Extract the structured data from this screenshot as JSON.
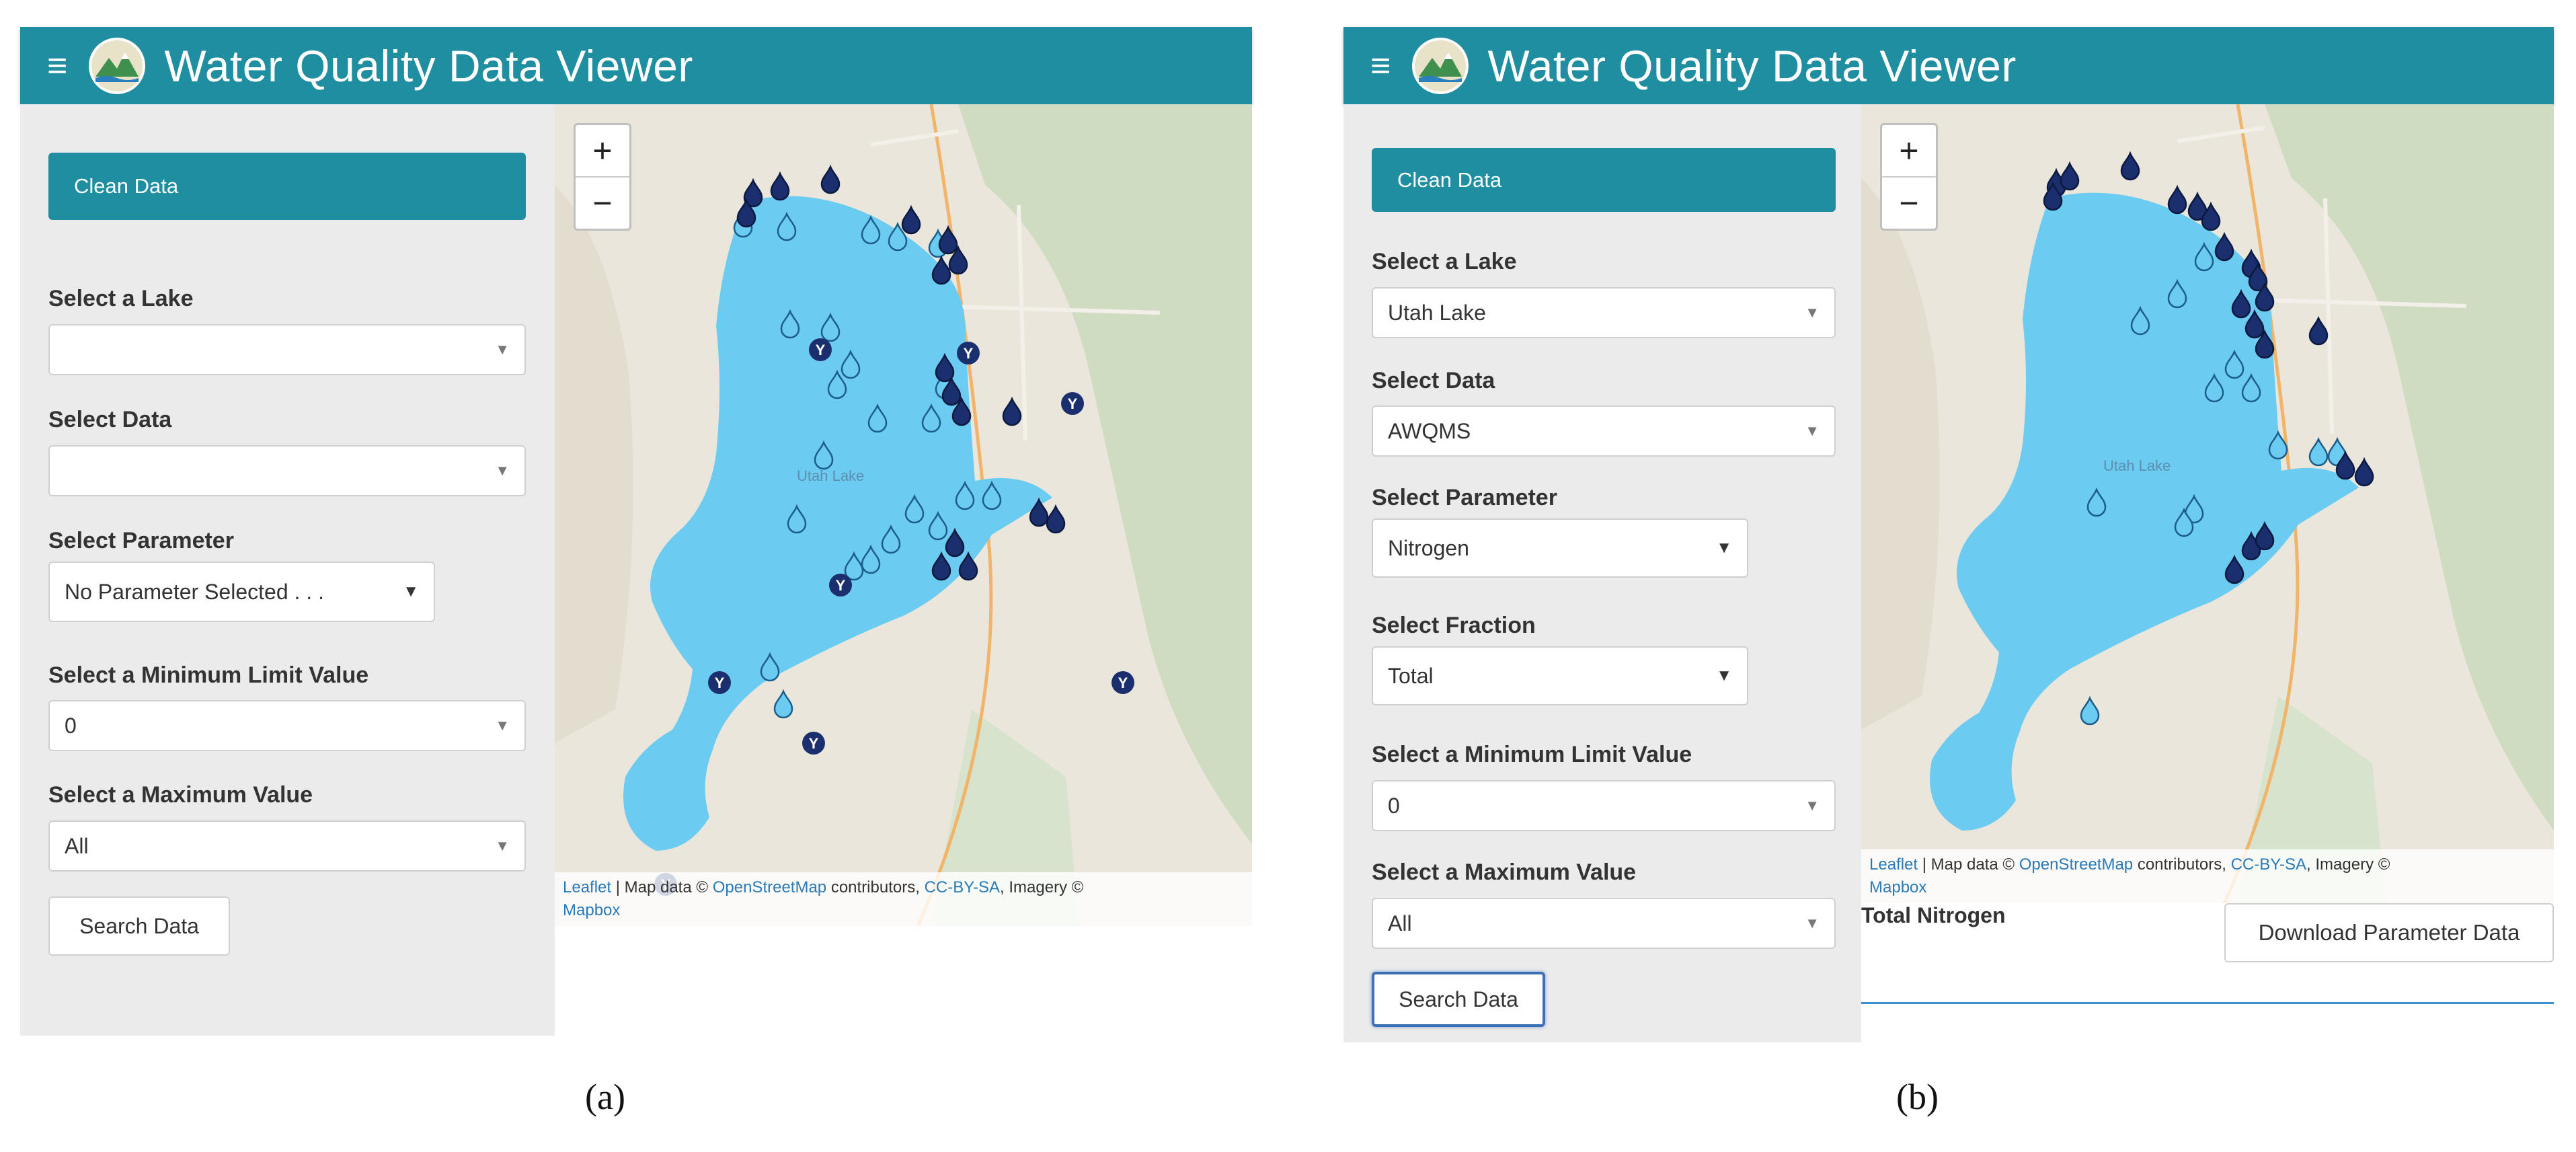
{
  "panels": {
    "a": {
      "header": {
        "title": "Water Quality Data Viewer"
      },
      "clean_button": "Clean Data",
      "labels": {
        "lake": "Select a Lake",
        "data": "Select Data",
        "parameter": "Select Parameter",
        "min": "Select a Minimum Limit Value",
        "max": "Select a Maximum Value"
      },
      "values": {
        "lake": "",
        "data": "",
        "parameter": "No Parameter Selected . . .",
        "min": "0",
        "max": "All"
      },
      "search_button": "Search Data",
      "map": {
        "zoom_in": "+",
        "zoom_out": "−",
        "lake_label": "Utah Lake",
        "attribution": {
          "leaflet": "Leaflet",
          "sep1": " | Map data © ",
          "osm": "OpenStreetMap",
          "sep2": " contributors, ",
          "license": "CC-BY-SA",
          "sep3": ", Imagery © ",
          "mapbox": "Mapbox"
        }
      },
      "caption": "(a)"
    },
    "b": {
      "header": {
        "title": "Water Quality Data Viewer"
      },
      "clean_button": "Clean Data",
      "labels": {
        "lake": "Select a Lake",
        "data": "Select Data",
        "parameter": "Select Parameter",
        "fraction": "Select Fraction",
        "min": "Select a Minimum Limit Value",
        "max": "Select a Maximum Value"
      },
      "values": {
        "lake": "Utah Lake",
        "data": "AWQMS",
        "parameter": "Nitrogen",
        "fraction": "Total",
        "min": "0",
        "max": "All"
      },
      "search_button": "Search Data",
      "map": {
        "zoom_in": "+",
        "zoom_out": "−",
        "lake_label": "Utah Lake",
        "attribution": {
          "leaflet": "Leaflet",
          "sep1": " | Map data © ",
          "osm": "OpenStreetMap",
          "sep2": " contributors, ",
          "license": "CC-BY-SA",
          "sep3": ", Imagery © ",
          "mapbox": "Mapbox"
        }
      },
      "parameter_title": "Total Nitrogen",
      "download_button": "Download Parameter Data",
      "caption": "(b)"
    }
  },
  "icons": {
    "menu": "hamburger-menu-icon",
    "logo": "mountain-water-logo-icon",
    "caret": "chevron-down-icon",
    "markers": [
      "water-drop-light-icon",
      "water-drop-dark-icon",
      "byu-y-icon"
    ]
  },
  "colors": {
    "header": "#1e8ea0",
    "sidebar": "#ebebeb",
    "lake": "#6ccbf1",
    "marker_light": "#6ccbf1",
    "marker_dark": "#1b2f6e",
    "link": "#2a7ab8"
  }
}
